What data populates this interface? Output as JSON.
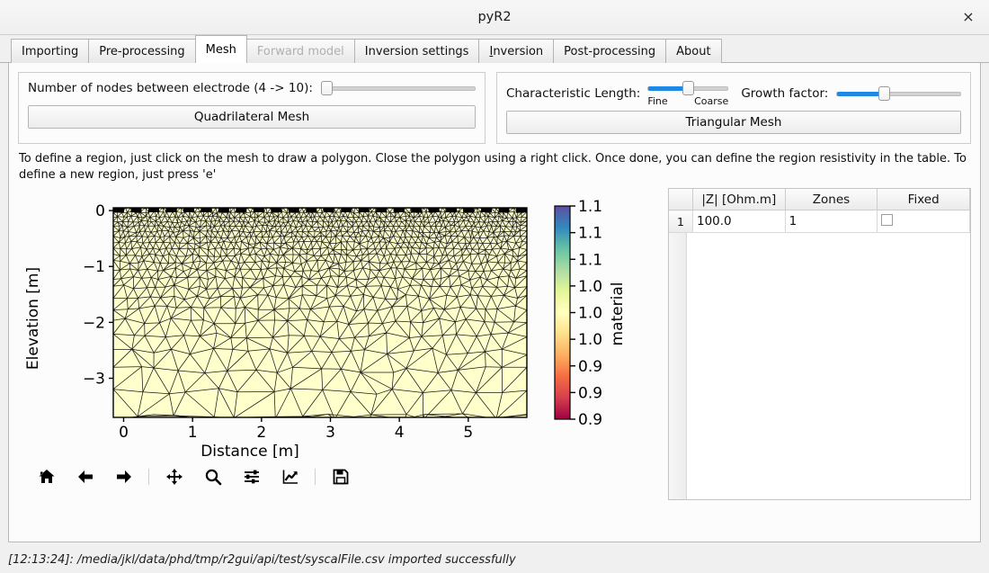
{
  "window": {
    "title": "pyR2",
    "close_label": "×"
  },
  "tabs": [
    {
      "label": "Importing",
      "state": "normal"
    },
    {
      "label": "Pre-processing",
      "state": "normal"
    },
    {
      "label": "Mesh",
      "state": "selected"
    },
    {
      "label": "Forward model",
      "state": "disabled"
    },
    {
      "label": "Inversion settings",
      "state": "normal"
    },
    {
      "label": "Inversion",
      "state": "normal",
      "mnemonic": "I"
    },
    {
      "label": "Post-processing",
      "state": "normal"
    },
    {
      "label": "About",
      "state": "normal"
    }
  ],
  "quad_panel": {
    "nodes_label": "Number of nodes between electrode (4 -> 10):",
    "nodes_slider_percent": 0,
    "button_label": "Quadrilateral Mesh"
  },
  "tri_panel": {
    "charlength_label": "Characteristic Length:",
    "charlength_min_label": "Fine",
    "charlength_max_label": "Coarse",
    "charlength_slider_percent": 50,
    "growth_label": "Growth factor:",
    "growth_slider_percent": 38,
    "button_label": "Triangular Mesh"
  },
  "hint": "To define a region, just click on the mesh to draw a polygon. Close the polygon using a right click. Once done, you can define the region resistivity in the table. To define a new region, just press 'e'",
  "chart_data": {
    "type": "heatmap",
    "title": "",
    "xlabel": "Distance [m]",
    "ylabel": "Elevation [m]",
    "xticks": [
      "0",
      "1",
      "2",
      "3",
      "4",
      "5"
    ],
    "yticks": [
      "0",
      "−1",
      "−2",
      "−3"
    ],
    "xlim": [
      -0.15,
      5.85
    ],
    "ylim": [
      -3.7,
      0.05
    ],
    "grid": false,
    "colorbar": {
      "label": "material",
      "ticks": [
        "1.1",
        "1.1",
        "1.1",
        "1.0",
        "1.0",
        "1.0",
        "0.9",
        "0.9",
        "0.9"
      ],
      "colormap": "Spectral_r",
      "stops": [
        "#5e4fa2",
        "#3288bd",
        "#66c2a5",
        "#abdda4",
        "#e6f598",
        "#ffffbf",
        "#fee08b",
        "#fdae61",
        "#f46d43",
        "#d53e4f",
        "#9e0142"
      ]
    },
    "mesh": {
      "type": "triangular",
      "fill_color": "#ffffcc",
      "edge_color": "#1a1a1a",
      "electrode_color": "#000000",
      "description": "Triangular finite-element mesh, fine near surface, coarsening with depth"
    }
  },
  "mpl_toolbar": [
    {
      "icon": "home-icon",
      "tooltip": "Home"
    },
    {
      "icon": "back-arrow-icon",
      "tooltip": "Back"
    },
    {
      "icon": "forward-arrow-icon",
      "tooltip": "Forward"
    },
    {
      "icon": "separator",
      "tooltip": ""
    },
    {
      "icon": "pan-move-icon",
      "tooltip": "Pan"
    },
    {
      "icon": "zoom-magnifier-icon",
      "tooltip": "Zoom"
    },
    {
      "icon": "subplot-sliders-icon",
      "tooltip": "Configure subplots"
    },
    {
      "icon": "edit-curve-icon",
      "tooltip": "Edit axis"
    },
    {
      "icon": "separator",
      "tooltip": ""
    },
    {
      "icon": "save-floppy-icon",
      "tooltip": "Save"
    }
  ],
  "region_table": {
    "columns": [
      "|Z| [Ohm.m]",
      "Zones",
      "Fixed"
    ],
    "rows": [
      {
        "number": "1",
        "resistivity": "100.0",
        "zones": "1",
        "fixed_checked": false
      }
    ]
  },
  "statusbar": {
    "message": "[12:13:24]: /media/jkl/data/phd/tmp/r2gui/api/test/syscalFile.csv imported successfully"
  }
}
